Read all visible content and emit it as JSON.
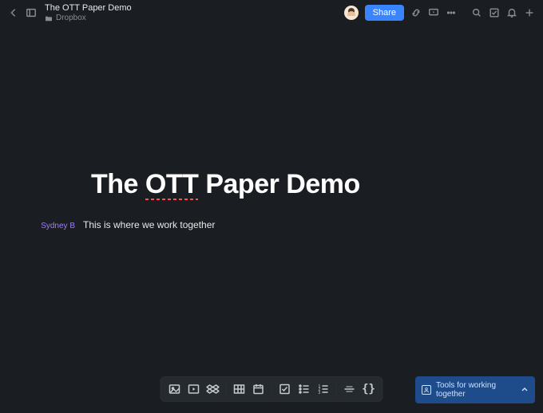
{
  "header": {
    "doc_title": "The OTT Paper Demo",
    "breadcrumb_folder": "Dropbox",
    "share_label": "Share"
  },
  "document": {
    "title_pre": "The ",
    "title_err": "OTT",
    "title_post": " Paper Demo",
    "author": "Sydney B",
    "body": "This is where we work together"
  },
  "callout": {
    "text": "Tools for working together"
  },
  "colors": {
    "accent": "#3984ff",
    "author": "#a07cff",
    "bg": "#1a1d21"
  }
}
